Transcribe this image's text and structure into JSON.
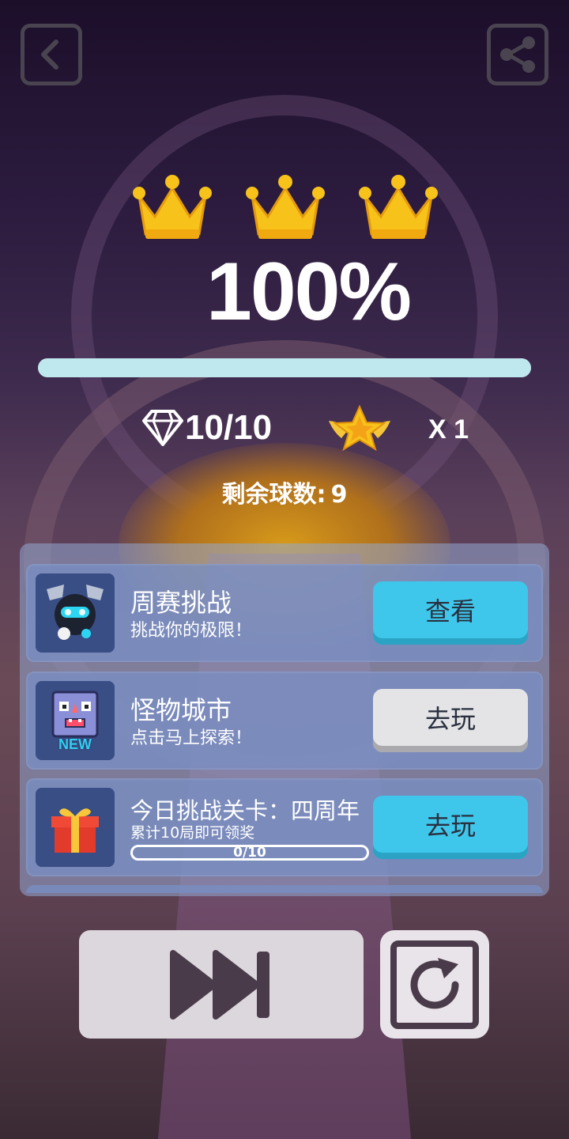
{
  "header": {
    "back_icon": "chevron-left-icon",
    "share_icon": "share-icon"
  },
  "result": {
    "crowns": 3,
    "crown_color": "#f7c21a",
    "percent_text": "100%",
    "progress_fraction": 1.0
  },
  "stats": {
    "gems_text": "10/10",
    "star_multiplier_text": "X 1",
    "remaining_label": "剩余球数:",
    "remaining_value": "9"
  },
  "cards": [
    {
      "icon": "robot-character-icon",
      "title": "周赛挑战",
      "subtitle": "挑战你的极限！",
      "button_label": "查看",
      "button_style": "cyan"
    },
    {
      "icon": "monster-new-icon",
      "badge": "NEW",
      "title": "怪物城市",
      "subtitle": "点击马上探索！",
      "button_label": "去玩",
      "button_style": "gray"
    },
    {
      "icon": "gift-box-icon",
      "title": "今日挑战关卡：四周年",
      "subtitle": "累计10局即可领奖",
      "progress_text": "0/10",
      "progress_fraction": 0,
      "button_label": "去玩",
      "button_style": "cyan"
    }
  ],
  "footer": {
    "skip_icon": "fast-forward-icon",
    "restart_icon": "restart-icon"
  },
  "colors": {
    "cyan_button": "#3ec7ea",
    "gray_button": "#e4e4e6",
    "progress_bar": "#bfe7ee"
  }
}
